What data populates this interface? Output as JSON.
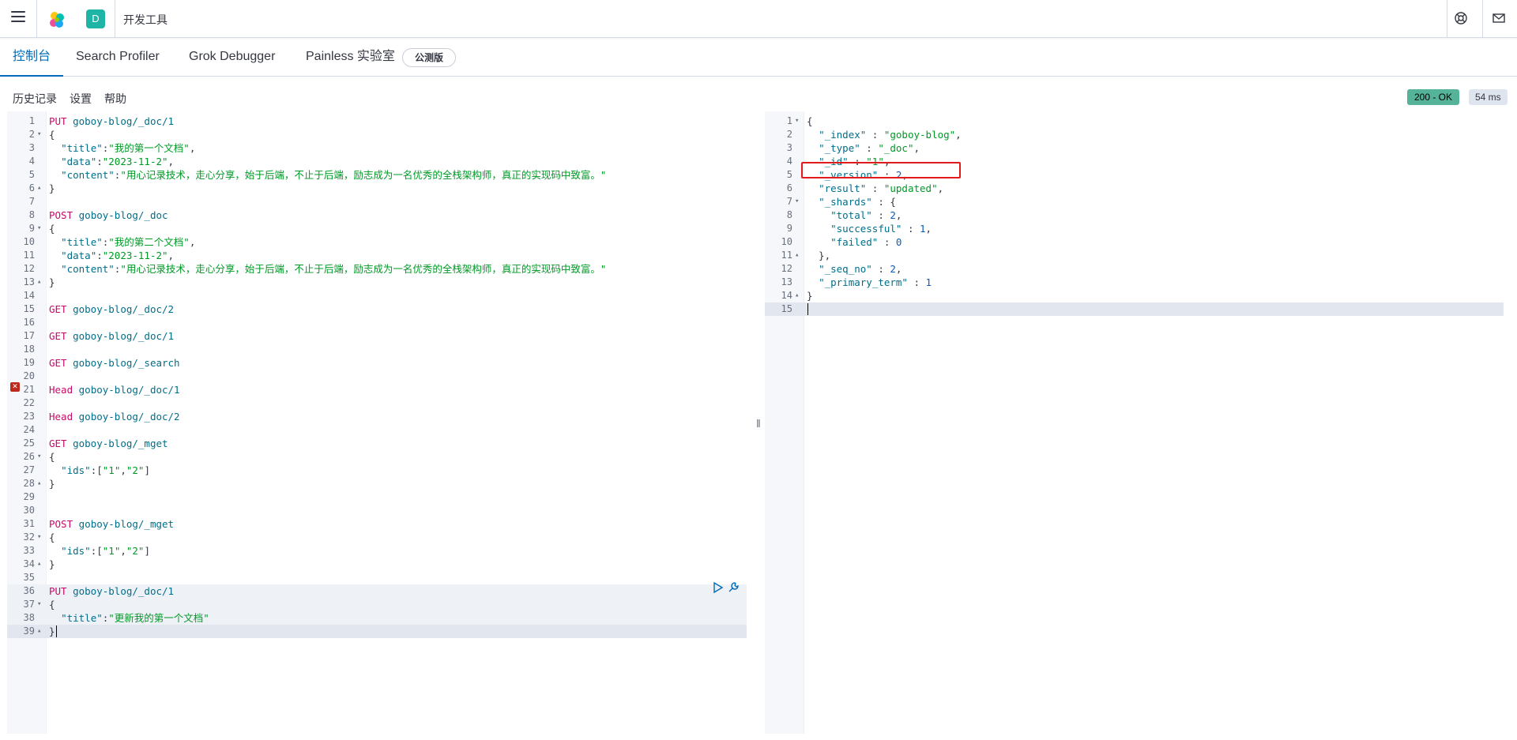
{
  "header": {
    "app_title": "开发工具",
    "space_initial": "D",
    "icons": [
      "menu-icon",
      "elastic-logo-icon",
      "help-icon",
      "mail-icon"
    ]
  },
  "tabs": [
    {
      "label": "控制台",
      "active": true
    },
    {
      "label": "Search Profiler",
      "active": false
    },
    {
      "label": "Grok Debugger",
      "active": false
    },
    {
      "label": "Painless 实验室",
      "active": false
    }
  ],
  "beta_badge": "公测版",
  "toolbar": {
    "history": "历史记录",
    "settings": "设置",
    "help": "帮助",
    "status": "200 - OK",
    "time": "54 ms"
  },
  "request_lines": [
    {
      "n": "1",
      "tokens": [
        [
          "m",
          "PUT"
        ],
        [
          "p",
          " "
        ],
        [
          "u",
          "goboy-blog/_doc/1"
        ]
      ]
    },
    {
      "n": "2",
      "fold": "▾",
      "tokens": [
        [
          "p",
          "{"
        ]
      ]
    },
    {
      "n": "3",
      "tokens": [
        [
          "p",
          "  "
        ],
        [
          "k",
          "\"title\""
        ],
        [
          "p",
          ":"
        ],
        [
          "s",
          "\"我的第一个文档\""
        ],
        [
          "p",
          ","
        ]
      ]
    },
    {
      "n": "4",
      "tokens": [
        [
          "p",
          "  "
        ],
        [
          "k",
          "\"data\""
        ],
        [
          "p",
          ":"
        ],
        [
          "s",
          "\"2023-11-2\""
        ],
        [
          "p",
          ","
        ]
      ]
    },
    {
      "n": "5",
      "tokens": [
        [
          "p",
          "  "
        ],
        [
          "k",
          "\"content\""
        ],
        [
          "p",
          ":"
        ],
        [
          "s",
          "\"用心记录技术，走心分享，始于后端，不止于后端，励志成为一名优秀的全栈架构师，真正的实现码中致富。\""
        ]
      ]
    },
    {
      "n": "6",
      "fold": "▴",
      "tokens": [
        [
          "p",
          "}"
        ]
      ]
    },
    {
      "n": "7",
      "tokens": []
    },
    {
      "n": "8",
      "tokens": [
        [
          "m",
          "POST"
        ],
        [
          "p",
          " "
        ],
        [
          "u",
          "goboy-blog/_doc"
        ]
      ]
    },
    {
      "n": "9",
      "fold": "▾",
      "tokens": [
        [
          "p",
          "{"
        ]
      ]
    },
    {
      "n": "10",
      "tokens": [
        [
          "p",
          "  "
        ],
        [
          "k",
          "\"title\""
        ],
        [
          "p",
          ":"
        ],
        [
          "s",
          "\"我的第二个文档\""
        ],
        [
          "p",
          ","
        ]
      ]
    },
    {
      "n": "11",
      "tokens": [
        [
          "p",
          "  "
        ],
        [
          "k",
          "\"data\""
        ],
        [
          "p",
          ":"
        ],
        [
          "s",
          "\"2023-11-2\""
        ],
        [
          "p",
          ","
        ]
      ]
    },
    {
      "n": "12",
      "tokens": [
        [
          "p",
          "  "
        ],
        [
          "k",
          "\"content\""
        ],
        [
          "p",
          ":"
        ],
        [
          "s",
          "\"用心记录技术，走心分享，始于后端，不止于后端，励志成为一名优秀的全栈架构师，真正的实现码中致富。\""
        ]
      ]
    },
    {
      "n": "13",
      "fold": "▴",
      "tokens": [
        [
          "p",
          "}"
        ]
      ]
    },
    {
      "n": "14",
      "tokens": []
    },
    {
      "n": "15",
      "tokens": [
        [
          "m",
          "GET"
        ],
        [
          "p",
          " "
        ],
        [
          "u",
          "goboy-blog/_doc/2"
        ]
      ]
    },
    {
      "n": "16",
      "tokens": []
    },
    {
      "n": "17",
      "tokens": [
        [
          "m",
          "GET"
        ],
        [
          "p",
          " "
        ],
        [
          "u",
          "goboy-blog/_doc/1"
        ]
      ]
    },
    {
      "n": "18",
      "tokens": []
    },
    {
      "n": "19",
      "tokens": [
        [
          "m",
          "GET"
        ],
        [
          "p",
          " "
        ],
        [
          "u",
          "goboy-blog/_search"
        ]
      ]
    },
    {
      "n": "20",
      "tokens": []
    },
    {
      "n": "21",
      "error": true,
      "tokens": [
        [
          "m",
          "Head"
        ],
        [
          "p",
          " "
        ],
        [
          "u",
          "goboy-blog/_doc/1"
        ]
      ]
    },
    {
      "n": "22",
      "tokens": []
    },
    {
      "n": "23",
      "tokens": [
        [
          "m",
          "Head"
        ],
        [
          "p",
          " "
        ],
        [
          "u",
          "goboy-blog/_doc/2"
        ]
      ]
    },
    {
      "n": "24",
      "tokens": []
    },
    {
      "n": "25",
      "tokens": [
        [
          "m",
          "GET"
        ],
        [
          "p",
          " "
        ],
        [
          "u",
          "goboy-blog/_mget"
        ]
      ]
    },
    {
      "n": "26",
      "fold": "▾",
      "tokens": [
        [
          "p",
          "{"
        ]
      ]
    },
    {
      "n": "27",
      "tokens": [
        [
          "p",
          "  "
        ],
        [
          "k",
          "\"ids\""
        ],
        [
          "p",
          ":["
        ],
        [
          "s",
          "\"1\""
        ],
        [
          "p",
          ","
        ],
        [
          "s",
          "\"2\""
        ],
        [
          "p",
          "]"
        ]
      ]
    },
    {
      "n": "28",
      "fold": "▴",
      "tokens": [
        [
          "p",
          "}"
        ]
      ]
    },
    {
      "n": "29",
      "tokens": []
    },
    {
      "n": "30",
      "tokens": []
    },
    {
      "n": "31",
      "tokens": [
        [
          "m",
          "POST"
        ],
        [
          "p",
          " "
        ],
        [
          "u",
          "goboy-blog/_mget"
        ]
      ]
    },
    {
      "n": "32",
      "fold": "▾",
      "tokens": [
        [
          "p",
          "{"
        ]
      ]
    },
    {
      "n": "33",
      "tokens": [
        [
          "p",
          "  "
        ],
        [
          "k",
          "\"ids\""
        ],
        [
          "p",
          ":["
        ],
        [
          "s",
          "\"1\""
        ],
        [
          "p",
          ","
        ],
        [
          "s",
          "\"2\""
        ],
        [
          "p",
          "]"
        ]
      ]
    },
    {
      "n": "34",
      "fold": "▴",
      "tokens": [
        [
          "p",
          "}"
        ]
      ]
    },
    {
      "n": "35",
      "tokens": []
    },
    {
      "n": "36",
      "tokens": [
        [
          "m",
          "PUT"
        ],
        [
          "p",
          " "
        ],
        [
          "u",
          "goboy-blog/_doc/1"
        ]
      ]
    },
    {
      "n": "37",
      "fold": "▾",
      "tokens": [
        [
          "p",
          "{"
        ]
      ]
    },
    {
      "n": "38",
      "tokens": [
        [
          "p",
          "  "
        ],
        [
          "k",
          "\"title\""
        ],
        [
          "p",
          ":"
        ],
        [
          "s",
          "\"更新我的第一个文档\""
        ]
      ]
    },
    {
      "n": "39",
      "fold": "▴",
      "tokens": [
        [
          "p",
          "}"
        ]
      ]
    }
  ],
  "response_lines": [
    {
      "n": "1",
      "fold": "▾",
      "tokens": [
        [
          "p",
          "{"
        ]
      ]
    },
    {
      "n": "2",
      "tokens": [
        [
          "p",
          "  "
        ],
        [
          "k",
          "\"_index\""
        ],
        [
          "p",
          " : "
        ],
        [
          "s",
          "\"goboy-blog\""
        ],
        [
          "p",
          ","
        ]
      ]
    },
    {
      "n": "3",
      "tokens": [
        [
          "p",
          "  "
        ],
        [
          "k",
          "\"_type\""
        ],
        [
          "p",
          " : "
        ],
        [
          "s",
          "\"_doc\""
        ],
        [
          "p",
          ","
        ]
      ]
    },
    {
      "n": "4",
      "tokens": [
        [
          "p",
          "  "
        ],
        [
          "k",
          "\"_id\""
        ],
        [
          "p",
          " : "
        ],
        [
          "s",
          "\"1\""
        ],
        [
          "p",
          ","
        ]
      ]
    },
    {
      "n": "5",
      "tokens": [
        [
          "p",
          "  "
        ],
        [
          "k",
          "\"_version\""
        ],
        [
          "p",
          " : "
        ],
        [
          "n",
          "2"
        ],
        [
          "p",
          ","
        ]
      ]
    },
    {
      "n": "6",
      "tokens": [
        [
          "p",
          "  "
        ],
        [
          "k",
          "\"result\""
        ],
        [
          "p",
          " : "
        ],
        [
          "s",
          "\"updated\""
        ],
        [
          "p",
          ","
        ]
      ]
    },
    {
      "n": "7",
      "fold": "▾",
      "tokens": [
        [
          "p",
          "  "
        ],
        [
          "k",
          "\"_shards\""
        ],
        [
          "p",
          " : {"
        ]
      ]
    },
    {
      "n": "8",
      "tokens": [
        [
          "p",
          "    "
        ],
        [
          "k",
          "\"total\""
        ],
        [
          "p",
          " : "
        ],
        [
          "n",
          "2"
        ],
        [
          "p",
          ","
        ]
      ]
    },
    {
      "n": "9",
      "tokens": [
        [
          "p",
          "    "
        ],
        [
          "k",
          "\"successful\""
        ],
        [
          "p",
          " : "
        ],
        [
          "n",
          "1"
        ],
        [
          "p",
          ","
        ]
      ]
    },
    {
      "n": "10",
      "tokens": [
        [
          "p",
          "    "
        ],
        [
          "k",
          "\"failed\""
        ],
        [
          "p",
          " : "
        ],
        [
          "n",
          "0"
        ]
      ]
    },
    {
      "n": "11",
      "fold": "▴",
      "tokens": [
        [
          "p",
          "  },"
        ]
      ]
    },
    {
      "n": "12",
      "tokens": [
        [
          "p",
          "  "
        ],
        [
          "k",
          "\"_seq_no\""
        ],
        [
          "p",
          " : "
        ],
        [
          "n",
          "2"
        ],
        [
          "p",
          ","
        ]
      ]
    },
    {
      "n": "13",
      "tokens": [
        [
          "p",
          "  "
        ],
        [
          "k",
          "\"_primary_term\""
        ],
        [
          "p",
          " : "
        ],
        [
          "n",
          "1"
        ]
      ]
    },
    {
      "n": "14",
      "fold": "▴",
      "tokens": [
        [
          "p",
          "}"
        ]
      ]
    },
    {
      "n": "15",
      "tokens": []
    }
  ]
}
